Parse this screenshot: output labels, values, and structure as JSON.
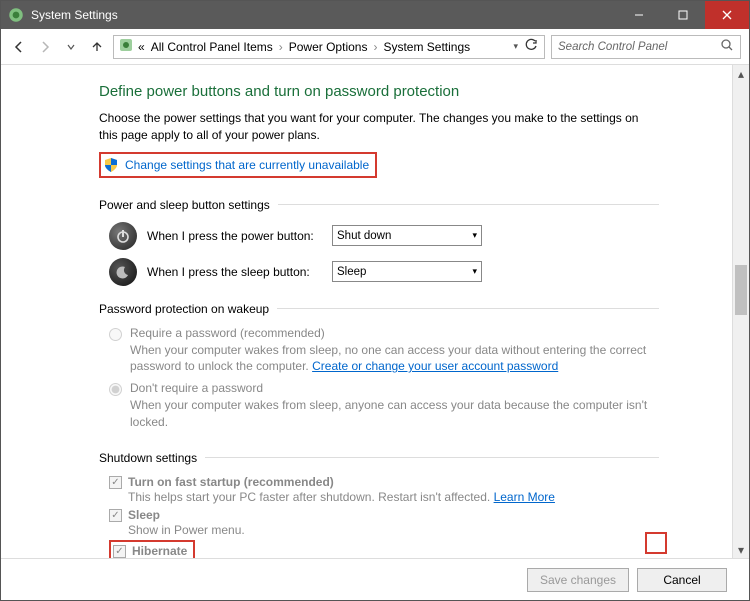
{
  "titlebar": {
    "title": "System Settings"
  },
  "nav": {
    "breadcrumb": {
      "seg1": "All Control Panel Items",
      "seg2": "Power Options",
      "seg3": "System Settings"
    },
    "search_placeholder": "Search Control Panel"
  },
  "main": {
    "heading": "Define power buttons and turn on password protection",
    "intro": "Choose the power settings that you want for your computer. The changes you make to the settings on this page apply to all of your power plans.",
    "change_link": "Change settings that are currently unavailable",
    "section_power": {
      "title": "Power and sleep button settings",
      "power_label": "When I press the power button:",
      "power_value": "Shut down",
      "sleep_label": "When I press the sleep button:",
      "sleep_value": "Sleep"
    },
    "section_password": {
      "title": "Password protection on wakeup",
      "opt1": {
        "label": "Require a password (recommended)",
        "desc1": "When your computer wakes from sleep, no one can access your data without entering the correct password to unlock the computer. ",
        "link": "Create or change your user account password"
      },
      "opt2": {
        "label": "Don't require a password",
        "desc": "When your computer wakes from sleep, anyone can access your data because the computer isn't locked."
      }
    },
    "section_shutdown": {
      "title": "Shutdown settings",
      "fast": {
        "label": "Turn on fast startup (recommended)",
        "desc": "This helps start your PC faster after shutdown. Restart isn't affected. ",
        "link": "Learn More"
      },
      "sleep": {
        "label": "Sleep",
        "desc": "Show in Power menu."
      },
      "hibernate": {
        "label": "Hibernate"
      }
    }
  },
  "footer": {
    "save": "Save changes",
    "cancel": "Cancel"
  }
}
